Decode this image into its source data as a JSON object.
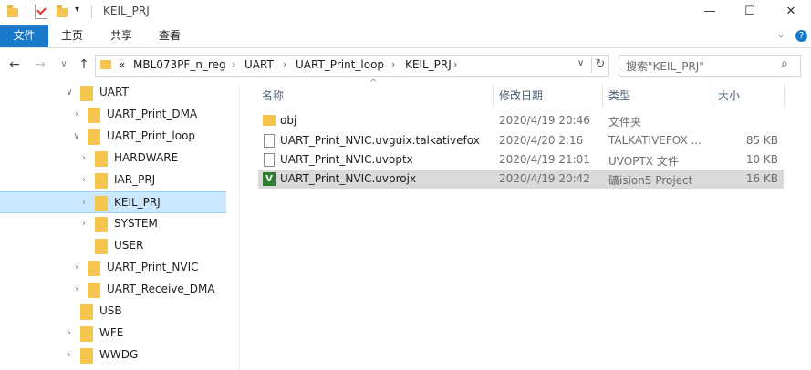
{
  "window": {
    "title": "KEIL_PRJ",
    "minimize_glyph": "—",
    "maximize_glyph": "☐",
    "close_glyph": "✕",
    "qat_glyph": "▾"
  },
  "ribbon": {
    "tabs": [
      "文件",
      "主页",
      "共享",
      "查看"
    ],
    "expand_glyph": "⌄",
    "help_glyph": "?"
  },
  "nav": {
    "back": "←",
    "forward": "→",
    "recent": "∨",
    "up": "↑"
  },
  "address": {
    "overflow": "«",
    "crumbs": [
      "MBL073PF_n_reg",
      "UART",
      "UART_Print_loop",
      "KEIL_PRJ"
    ],
    "separator": "›",
    "dropdown": "∨",
    "refresh": "↻"
  },
  "search": {
    "placeholder": "搜索\"KEIL_PRJ\"",
    "icon": "⌕"
  },
  "tree": [
    {
      "label": "UART",
      "chev": "∨"
    },
    {
      "label": "UART_Print_DMA",
      "chev": "›"
    },
    {
      "label": "UART_Print_loop",
      "chev": "∨"
    },
    {
      "label": "HARDWARE",
      "chev": "›"
    },
    {
      "label": "IAR_PRJ",
      "chev": "›"
    },
    {
      "label": "KEIL_PRJ",
      "chev": "›"
    },
    {
      "label": "SYSTEM",
      "chev": "›"
    },
    {
      "label": "USER",
      "chev": ""
    },
    {
      "label": "UART_Print_NVIC",
      "chev": "›"
    },
    {
      "label": "UART_Receive_DMA",
      "chev": "›"
    },
    {
      "label": "USB",
      "chev": ""
    },
    {
      "label": "WFE",
      "chev": "›"
    },
    {
      "label": "WWDG",
      "chev": "›"
    }
  ],
  "columns": {
    "name": "名称",
    "modified": "修改日期",
    "type": "类型",
    "size": "大小",
    "sort_glyph": "^"
  },
  "files": [
    {
      "name": "obj",
      "modified": "2020/4/19 20:46",
      "type": "文件夹",
      "size": "",
      "icon": "folder-icon"
    },
    {
      "name": "UART_Print_NVIC.uvguix.talkativefox",
      "modified": "2020/4/20 2:16",
      "type": "TALKATIVEFOX ...",
      "size": "85 KB",
      "icon": "file-icon"
    },
    {
      "name": "UART_Print_NVIC.uvoptx",
      "modified": "2020/4/19 21:01",
      "type": "UVOPTX 文件",
      "size": "10 KB",
      "icon": "file-icon"
    },
    {
      "name": "UART_Print_NVIC.uvprojx",
      "modified": "2020/4/19 20:42",
      "type": "礦ision5 Project",
      "size": "16 KB",
      "icon": "uvision-icon"
    }
  ],
  "uv_icon_letter": "V"
}
